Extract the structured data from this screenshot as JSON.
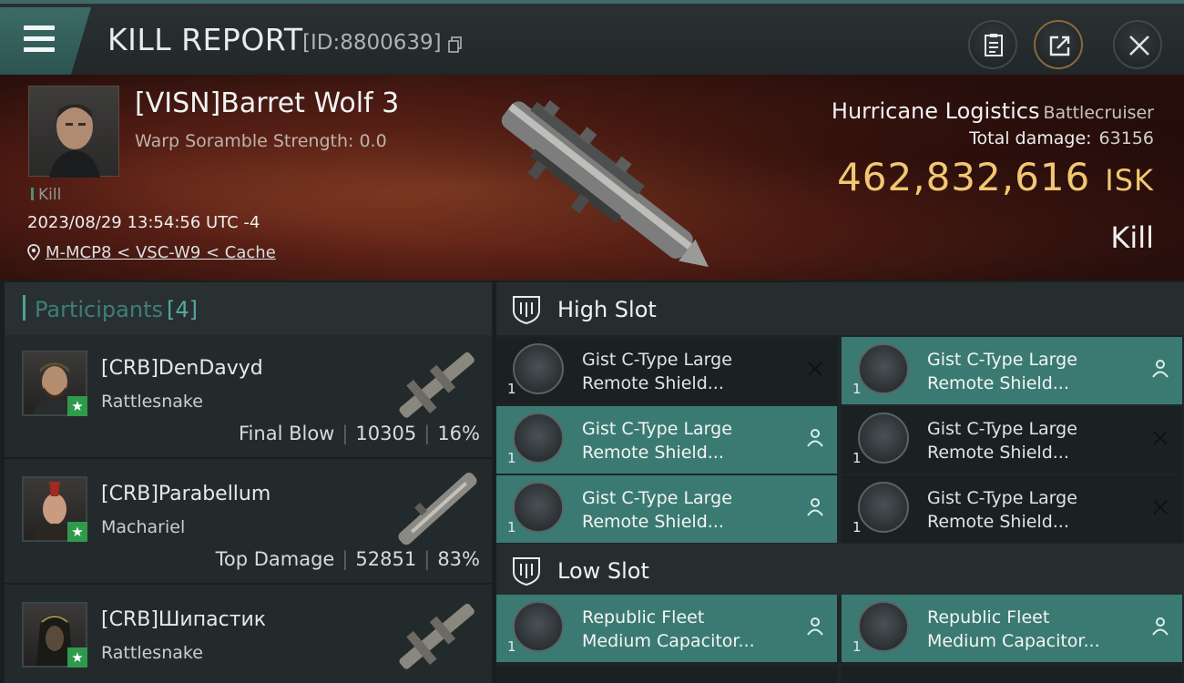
{
  "header": {
    "title": "KILL REPORT",
    "report_id": "[ID:8800639]"
  },
  "victim": {
    "name": "[VISN]Barret Wolf 3",
    "warp_scramble": "Warp Soramble Strength: 0.0",
    "tag": "Kill",
    "timestamp": "2023/08/29 13:54:56 UTC -4",
    "location": "M-MCP8 < VSC-W9 < Cache"
  },
  "ship": {
    "name": "Hurricane Logistics",
    "class": "Battlecruiser",
    "total_damage_label": "Total damage:",
    "total_damage": "63156",
    "isk_value": "462,832,616",
    "isk_unit": "ISK",
    "result": "Kill"
  },
  "participants": {
    "title": "Participants",
    "count": "[4]",
    "rows": [
      {
        "name": "[CRB]DenDavyd",
        "ship": "Rattlesnake",
        "role": "Final Blow",
        "damage": "10305",
        "percent": "16%"
      },
      {
        "name": "[CRB]Parabellum",
        "ship": "Machariel",
        "role": "Top Damage",
        "damage": "52851",
        "percent": "83%"
      },
      {
        "name": "[CRB]Шипастик",
        "ship": "Rattlesnake",
        "role": "",
        "damage": "",
        "percent": ""
      }
    ]
  },
  "high_slot": {
    "title": "High Slot",
    "modules": [
      {
        "line1": "Gist C-Type Large",
        "line2": "Remote Shield...",
        "qty": "1",
        "status": "destroyed"
      },
      {
        "line1": "Gist C-Type Large",
        "line2": "Remote Shield...",
        "qty": "1",
        "status": "dropped"
      },
      {
        "line1": "Gist C-Type Large",
        "line2": "Remote Shield...",
        "qty": "1",
        "status": "dropped"
      },
      {
        "line1": "Gist C-Type Large",
        "line2": "Remote Shield...",
        "qty": "1",
        "status": "destroyed"
      },
      {
        "line1": "Gist C-Type Large",
        "line2": "Remote Shield...",
        "qty": "1",
        "status": "dropped"
      },
      {
        "line1": "Gist C-Type Large",
        "line2": "Remote Shield...",
        "qty": "1",
        "status": "destroyed"
      }
    ]
  },
  "low_slot": {
    "title": "Low Slot",
    "modules": [
      {
        "line1": "Republic Fleet",
        "line2": "Medium Capacitor...",
        "qty": "1",
        "status": "dropped"
      },
      {
        "line1": "Republic Fleet",
        "line2": "Medium Capacitor...",
        "qty": "1",
        "status": "dropped"
      }
    ]
  },
  "colors": {
    "accent_teal": "#3b7a72",
    "isk_gold": "#f1c772",
    "banner_red": "#6a2a1c"
  },
  "icons": [
    "menu-icon",
    "copy-icon",
    "report-icon",
    "share-icon",
    "close-icon",
    "location-pin-icon",
    "shield-slot-icon",
    "destroyed-x-icon",
    "dropped-person-icon",
    "star-icon"
  ]
}
